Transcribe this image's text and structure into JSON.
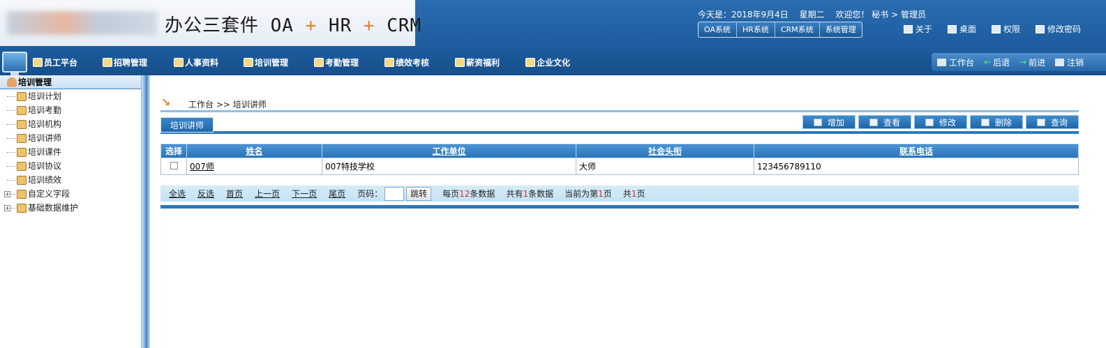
{
  "header": {
    "app_title_a": "办公三套件 OA ",
    "app_title_plus1": "+",
    "app_title_b": " HR ",
    "app_title_plus2": "+",
    "app_title_c": " CRM",
    "date_text": "今天是：2018年9月4日",
    "weekday_text": "星期二",
    "welcome_text": "欢迎您！ 秘书 > 管理员",
    "systems": [
      "OA系统",
      "HR系统",
      "CRM系统",
      "系统管理"
    ],
    "top_links": [
      "关于",
      "桌面",
      "权限",
      "修改密码"
    ]
  },
  "nav": {
    "items": [
      "员工平台",
      "招聘管理",
      "人事资料",
      "培训管理",
      "考勤管理",
      "绩效考核",
      "薪资福利",
      "企业文化"
    ],
    "right": {
      "workbench": "工作台",
      "back": "后退",
      "forward": "前进",
      "logout": "注销"
    }
  },
  "sidebar": {
    "title": "培训管理",
    "items": [
      "培训计划",
      "培训考勤",
      "培训机构",
      "培训讲师",
      "培训课件",
      "培训协议",
      "培训绩效"
    ],
    "folders": [
      "自定义字段",
      "基础数据维护"
    ]
  },
  "main": {
    "breadcrumb": "工作台 >> 培训讲师",
    "tab": "培训讲师",
    "buttons": {
      "add": "增加",
      "view": "查看",
      "edit": "修改",
      "delete": "删除",
      "query": "查询"
    },
    "table": {
      "headers": [
        "选择",
        "姓名",
        "工作单位",
        "社会头衔",
        "联系电话"
      ],
      "rows": [
        {
          "name": "007师",
          "unit": "007特技学校",
          "title": "大师",
          "phone": "123456789110"
        }
      ]
    },
    "pager": {
      "select_all": "全选",
      "invert": "反选",
      "first": "首页",
      "prev": "上一页",
      "next": "下一页",
      "last": "尾页",
      "page_label": "页码：",
      "go": "跳转",
      "per_page_pre": "每页",
      "per_page": "12",
      "per_page_post": "条数据",
      "total_pre": "共有",
      "total": "1",
      "total_post": "条数据",
      "current_pre": "当前为第",
      "current": "1",
      "current_post": "页",
      "pages_pre": "共",
      "pages": "1",
      "pages_post": "页"
    }
  },
  "colors": {
    "header_blue": "#1d5d9f",
    "accent_orange": "#e0832a",
    "link_red": "#e0261e"
  }
}
